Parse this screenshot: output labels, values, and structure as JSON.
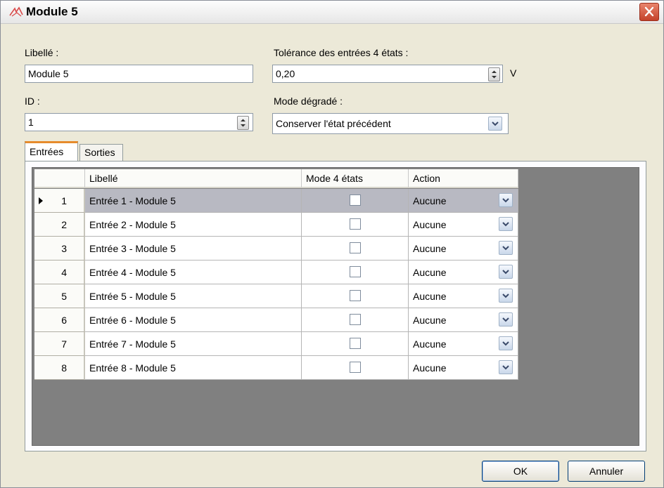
{
  "window": {
    "title": "Module 5"
  },
  "form": {
    "libelle_label": "Libellé :",
    "libelle_value": "Module 5",
    "id_label": "ID :",
    "id_value": "1",
    "tolerance_label": "Tolérance des entrées 4 états :",
    "tolerance_value": "0,20",
    "tolerance_unit": "V",
    "mode_label": "Mode dégradé :",
    "mode_value": "Conserver l'état précédent"
  },
  "tabs": [
    {
      "label": "Entrées",
      "active": true
    },
    {
      "label": "Sorties",
      "active": false
    }
  ],
  "grid": {
    "columns": [
      "Libellé",
      "Mode 4 états",
      "Action"
    ],
    "rows": [
      {
        "num": "1",
        "libelle": "Entrée 1 - Module 5",
        "mode4": false,
        "action": "Aucune",
        "current": true
      },
      {
        "num": "2",
        "libelle": "Entrée 2 - Module 5",
        "mode4": false,
        "action": "Aucune"
      },
      {
        "num": "3",
        "libelle": "Entrée 3 - Module 5",
        "mode4": false,
        "action": "Aucune"
      },
      {
        "num": "4",
        "libelle": "Entrée 4 - Module 5",
        "mode4": false,
        "action": "Aucune"
      },
      {
        "num": "5",
        "libelle": "Entrée 5 - Module 5",
        "mode4": false,
        "action": "Aucune"
      },
      {
        "num": "6",
        "libelle": "Entrée 6 - Module 5",
        "mode4": false,
        "action": "Aucune"
      },
      {
        "num": "7",
        "libelle": "Entrée 7 - Module 5",
        "mode4": false,
        "action": "Aucune"
      },
      {
        "num": "8",
        "libelle": "Entrée 8 - Module 5",
        "mode4": false,
        "action": "Aucune"
      }
    ]
  },
  "buttons": {
    "ok": "OK",
    "cancel": "Annuler"
  },
  "colors": {
    "selected_row": "#b8b9c2",
    "grid_background": "#808080",
    "close_button": "#c4422a"
  }
}
